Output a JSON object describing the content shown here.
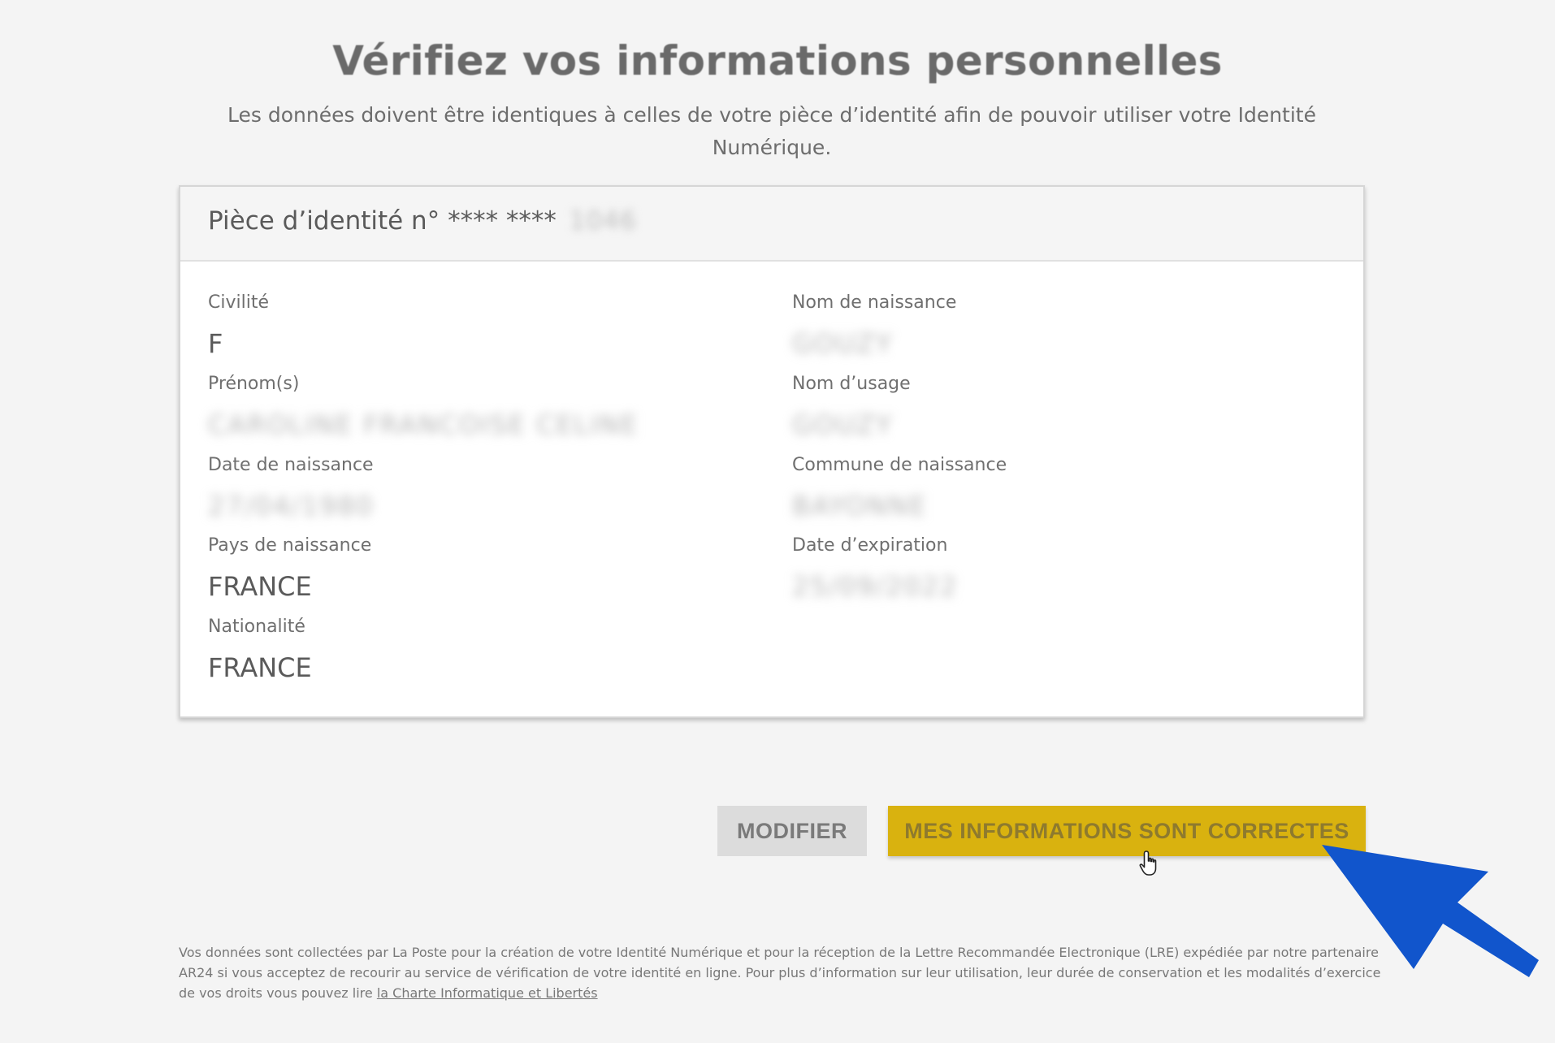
{
  "header": {
    "title": "Vérifiez vos informations personnelles",
    "subtitle": "Les données doivent être identiques à celles de votre pièce d’identité afin de pouvoir utiliser votre Identité Numérique."
  },
  "card": {
    "title_prefix": "Pièce d’identité n°",
    "title_mask": "**** ****",
    "title_hidden": "1046",
    "left_fields": [
      {
        "label": "Civilité",
        "value": "F",
        "blurred": false
      },
      {
        "label": "Prénom(s)",
        "value": "CAROLINE FRANCOISE CELINE",
        "blurred": true
      },
      {
        "label": "Date de naissance",
        "value": "27/04/1980",
        "blurred": true
      },
      {
        "label": "Pays de naissance",
        "value": "FRANCE",
        "blurred": false
      },
      {
        "label": "Nationalité",
        "value": "FRANCE",
        "blurred": false
      }
    ],
    "right_fields": [
      {
        "label": "Nom de naissance",
        "value": "GOUZY",
        "blurred": true
      },
      {
        "label": "Nom d’usage",
        "value": "GOUZY",
        "blurred": true
      },
      {
        "label": "Commune de naissance",
        "value": "BAYONNE",
        "blurred": true
      },
      {
        "label": "Date d’expiration",
        "value": "25/09/2022",
        "blurred": true
      }
    ]
  },
  "actions": {
    "modify_label": "MODIFIER",
    "confirm_label": "MES INFORMATIONS SONT CORRECTES"
  },
  "footer": {
    "text": "Vos données sont collectées par La Poste pour la création de votre Identité Numérique et pour la réception de la Lettre Recommandée Electronique (LRE) expédiée par notre partenaire AR24 si vous acceptez de recourir au service de vérification de votre identité en ligne. Pour plus d’information sur leur utilisation, leur durée de conservation et les modalités d’exercice de vos droits vous pouvez lire",
    "link_label": "la Charte Informatique et Libertés"
  },
  "colors": {
    "background": "#f4f4f4",
    "confirm_button": "#d9b20f",
    "modify_button": "#dcdcdc",
    "annotation_arrow": "#1155cc"
  },
  "icons": {
    "cursor": "hand-pointer-icon",
    "annotation": "arrow-pointer-icon"
  }
}
